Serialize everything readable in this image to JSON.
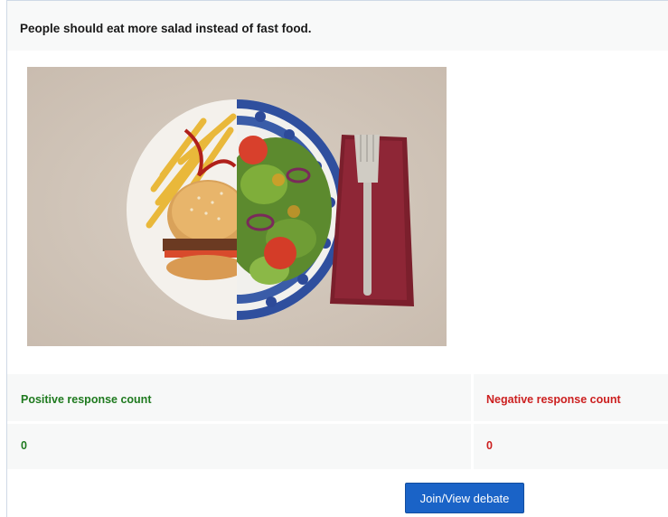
{
  "debate": {
    "statement": "People should eat more salad instead of fast food."
  },
  "image": {
    "description": "plate-half-burger-fries-half-salad"
  },
  "responses": {
    "positive_label": "Positive response count",
    "negative_label": "Negative response count",
    "positive_count": "0",
    "negative_count": "0",
    "positive_color": "#1f7a1f",
    "negative_color": "#cc1f1f"
  },
  "actions": {
    "join_label": "Join/View debate",
    "button_color": "#1a63c7"
  }
}
